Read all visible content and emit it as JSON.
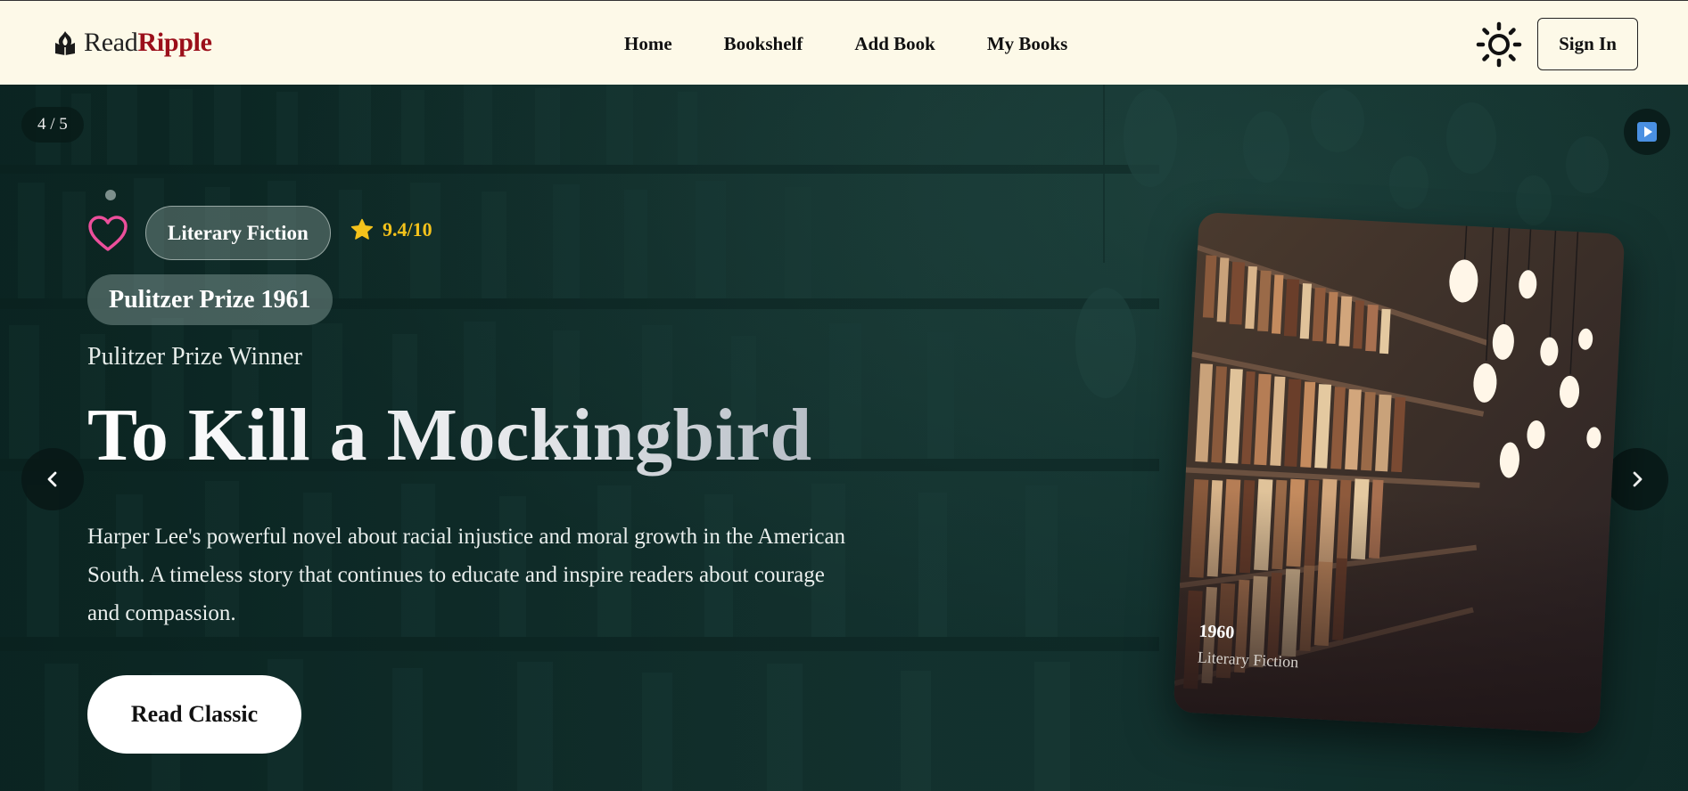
{
  "brand": {
    "prefix": "Read",
    "accent": "Ripple",
    "icon": "flame-book-icon"
  },
  "nav": {
    "links": [
      {
        "label": "Home"
      },
      {
        "label": "Bookshelf"
      },
      {
        "label": "Add Book"
      },
      {
        "label": "My Books"
      }
    ],
    "theme_icon": "sun-icon",
    "signin_label": "Sign In"
  },
  "hero": {
    "counter": "4 / 5",
    "genre": "Literary Fiction",
    "rating": "9.4/10",
    "award": "Pulitzer Prize 1961",
    "subtitle": "Pulitzer Prize Winner",
    "title": "To Kill a Mockingbird",
    "description": "Harper Lee's powerful novel about racial injustice and moral growth in the American South. A timeless story that continues to educate and inspire readers about courage and compassion.",
    "cta_label": "Read Classic",
    "card": {
      "year": "1960",
      "genre": "Literary Fiction"
    }
  },
  "colors": {
    "accent": "#9b0f1a",
    "rating": "#f4c21b",
    "heart": "#ec4f9b",
    "play": "#4a90e2"
  }
}
